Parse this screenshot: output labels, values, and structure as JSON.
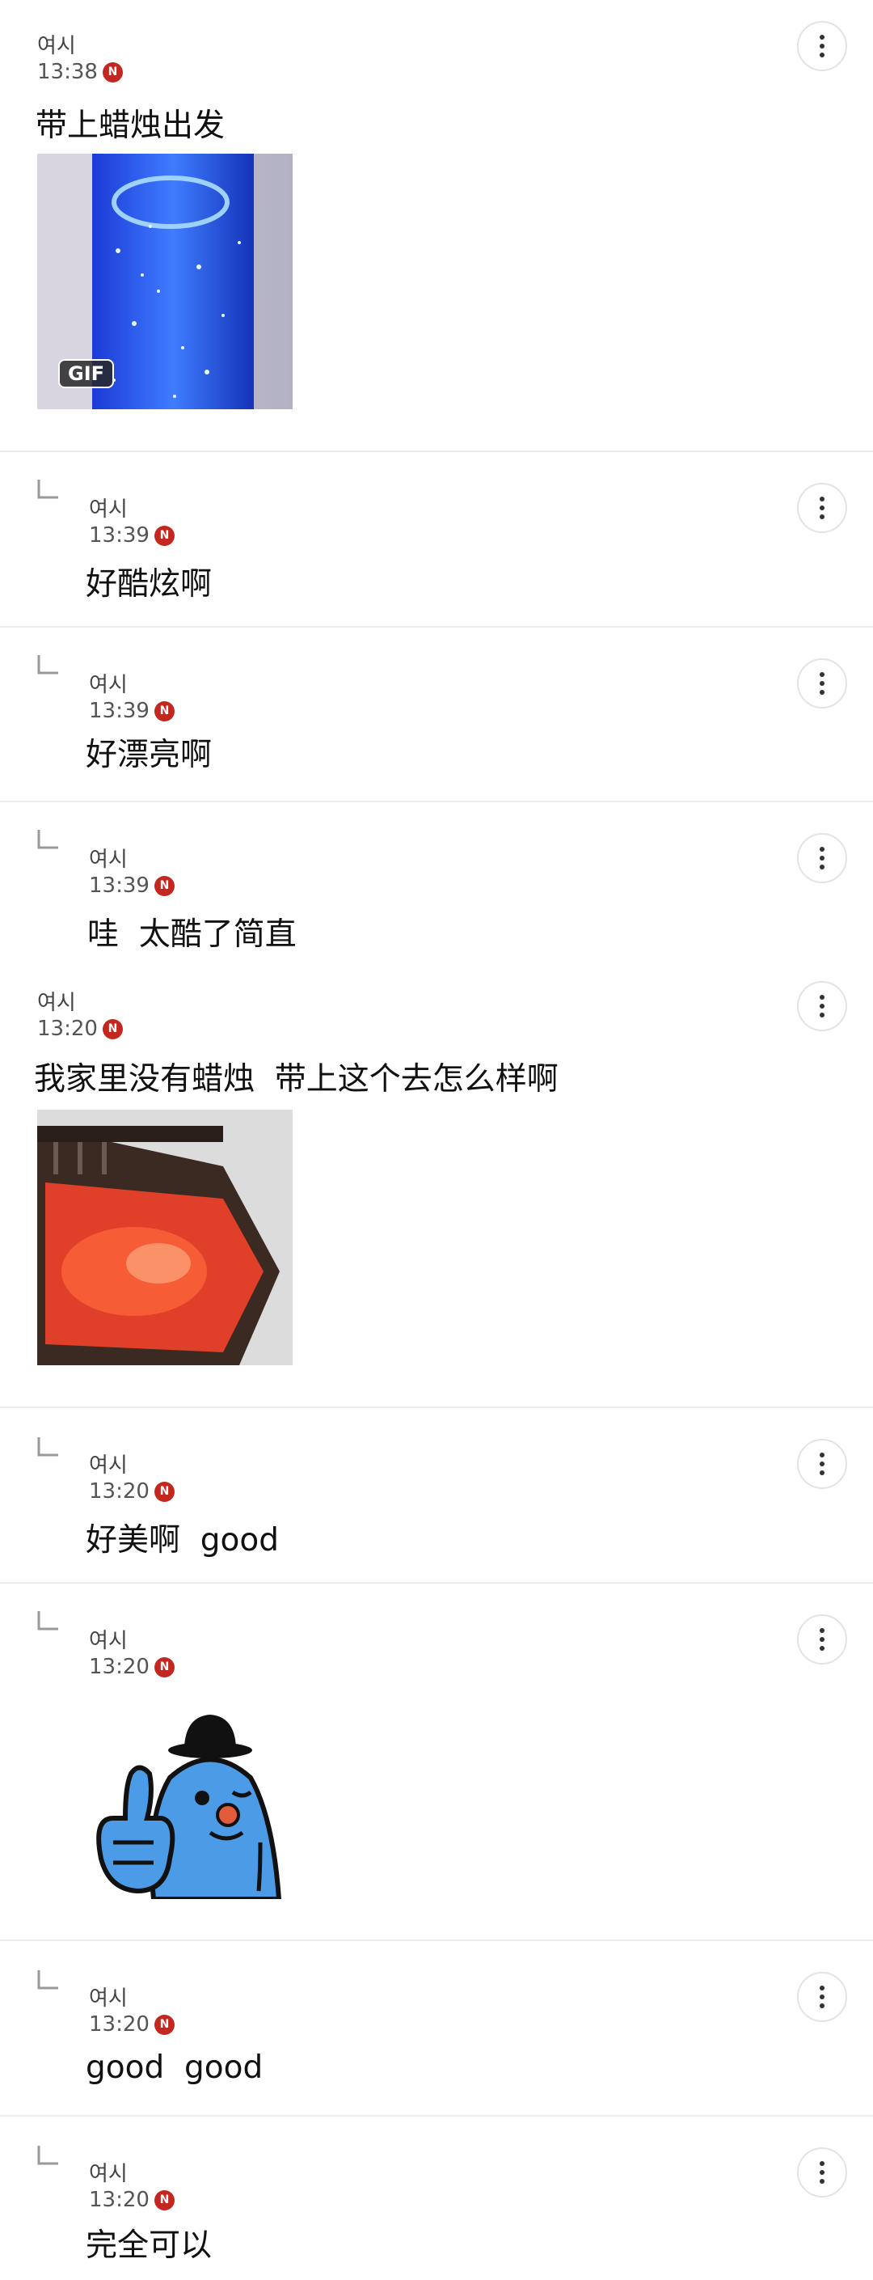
{
  "comments": [
    {
      "name": "여시",
      "time": "13:38",
      "badge": "N",
      "text": "带上蜡烛出发",
      "media_badge": "GIF"
    },
    {
      "name": "여시",
      "time": "13:39",
      "badge": "N",
      "text": "好酷炫啊"
    },
    {
      "name": "여시",
      "time": "13:39",
      "badge": "N",
      "text": "好漂亮啊"
    },
    {
      "name": "여시",
      "time": "13:39",
      "badge": "N",
      "text": "哇  太酷了简直"
    },
    {
      "name": "여시",
      "time": "13:20",
      "badge": "N",
      "text": "我家里没有蜡烛  带上这个去怎么样啊"
    },
    {
      "name": "여시",
      "time": "13:20",
      "badge": "N",
      "text": "好美啊  good"
    },
    {
      "name": "여시",
      "time": "13:20",
      "badge": "N",
      "text": ""
    },
    {
      "name": "여시",
      "time": "13:20",
      "badge": "N",
      "text": "good  good"
    },
    {
      "name": "여시",
      "time": "13:20",
      "badge": "N",
      "text": "完全可以"
    }
  ],
  "icons": {
    "more": "more-vertical-icon",
    "reply": "reply-arrow-icon",
    "badge": "new-badge-icon"
  },
  "colors": {
    "badge": "#c2281f",
    "divider": "#ececec"
  }
}
